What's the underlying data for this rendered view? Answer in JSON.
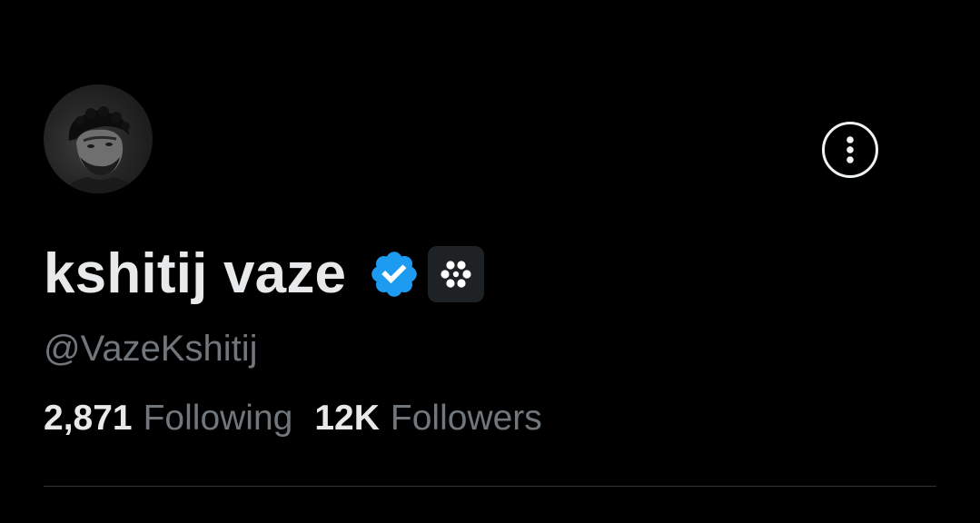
{
  "profile": {
    "display_name": "kshitij vaze",
    "handle": "@VazeKshitij",
    "verified_icon": "verified-badge-icon",
    "affiliate_icon": "affiliate-badge-icon",
    "avatar_icon": "avatar-photo"
  },
  "header": {
    "more_icon": "more-options-icon"
  },
  "stats": {
    "following_count": "2,871",
    "following_label": "Following",
    "followers_count": "12K",
    "followers_label": "Followers"
  },
  "colors": {
    "background": "#000000",
    "primary_text": "#e7e9ea",
    "secondary_text": "#71767b",
    "verified_blue": "#1d9bf0",
    "divider": "#2f3336"
  }
}
